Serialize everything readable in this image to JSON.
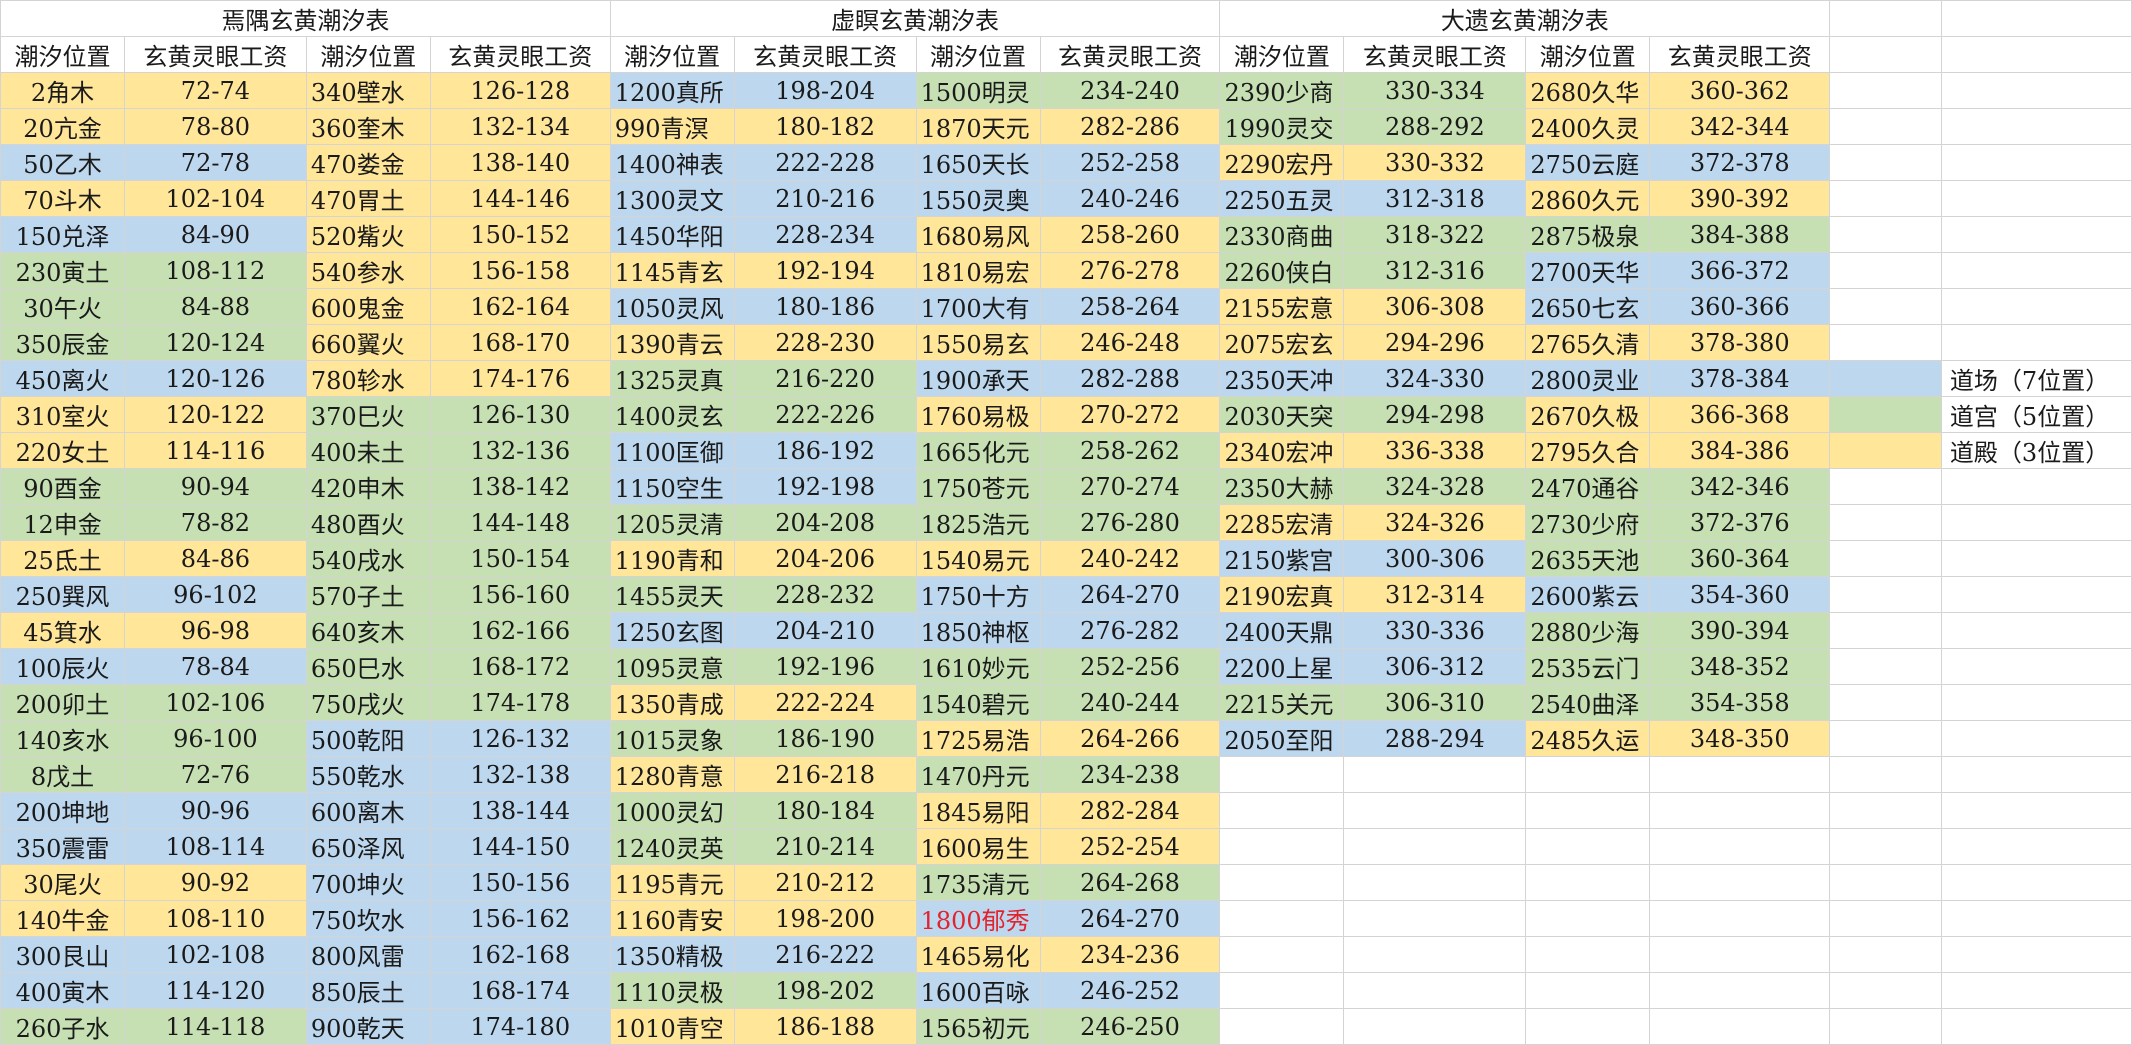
{
  "colors": {
    "Y": "#ffe699",
    "B": "#bdd7ee",
    "G": "#c6e0b4",
    "highlight_text": "#e0242f"
  },
  "titles": [
    "焉隅玄黄潮汐表",
    "虚瞑玄黄潮汐表",
    "大遗玄黄潮汐表"
  ],
  "header": [
    "潮汐位置",
    "玄黄灵眼工资"
  ],
  "legend": [
    {
      "label": "道场（7位置）",
      "color": "B"
    },
    {
      "label": "道宫（5位置）",
      "color": "G"
    },
    {
      "label": "道殿（3位置）",
      "color": "Y"
    }
  ],
  "tables": [
    {
      "left": [
        {
          "pos": "2角木",
          "val": "72-74",
          "c": "Y"
        },
        {
          "pos": "20亢金",
          "val": "78-80",
          "c": "Y"
        },
        {
          "pos": "50乙木",
          "val": "72-78",
          "c": "B"
        },
        {
          "pos": "70斗木",
          "val": "102-104",
          "c": "Y"
        },
        {
          "pos": "150兑泽",
          "val": "84-90",
          "c": "B"
        },
        {
          "pos": "230寅土",
          "val": "108-112",
          "c": "G"
        },
        {
          "pos": "30午火",
          "val": "84-88",
          "c": "G"
        },
        {
          "pos": "350辰金",
          "val": "120-124",
          "c": "G"
        },
        {
          "pos": "450离火",
          "val": "120-126",
          "c": "B"
        },
        {
          "pos": "310室火",
          "val": "120-122",
          "c": "Y"
        },
        {
          "pos": "220女土",
          "val": "114-116",
          "c": "Y"
        },
        {
          "pos": "90酉金",
          "val": "90-94",
          "c": "G"
        },
        {
          "pos": "12申金",
          "val": "78-82",
          "c": "G"
        },
        {
          "pos": "25氐土",
          "val": "84-86",
          "c": "Y"
        },
        {
          "pos": "250巽风",
          "val": "96-102",
          "c": "B"
        },
        {
          "pos": "45箕水",
          "val": "96-98",
          "c": "Y"
        },
        {
          "pos": "100辰火",
          "val": "78-84",
          "c": "B"
        },
        {
          "pos": "200卯土",
          "val": "102-106",
          "c": "G"
        },
        {
          "pos": "140亥水",
          "val": "96-100",
          "c": "G"
        },
        {
          "pos": "8戊土",
          "val": "72-76",
          "c": "G"
        },
        {
          "pos": "200坤地",
          "val": "90-96",
          "c": "B"
        },
        {
          "pos": "350震雷",
          "val": "108-114",
          "c": "B"
        },
        {
          "pos": "30尾火",
          "val": "90-92",
          "c": "Y"
        },
        {
          "pos": "140牛金",
          "val": "108-110",
          "c": "Y"
        },
        {
          "pos": "300艮山",
          "val": "102-108",
          "c": "B"
        },
        {
          "pos": "400寅木",
          "val": "114-120",
          "c": "B"
        },
        {
          "pos": "260子水",
          "val": "114-118",
          "c": "G"
        }
      ],
      "right": [
        {
          "pos": "340壁水",
          "val": "126-128",
          "c": "Y"
        },
        {
          "pos": "360奎木",
          "val": "132-134",
          "c": "Y"
        },
        {
          "pos": "470娄金",
          "val": "138-140",
          "c": "Y"
        },
        {
          "pos": "470胃土",
          "val": "144-146",
          "c": "Y"
        },
        {
          "pos": "520觜火",
          "val": "150-152",
          "c": "Y"
        },
        {
          "pos": "540参水",
          "val": "156-158",
          "c": "Y"
        },
        {
          "pos": "600鬼金",
          "val": "162-164",
          "c": "Y"
        },
        {
          "pos": "660翼火",
          "val": "168-170",
          "c": "Y"
        },
        {
          "pos": "780轸水",
          "val": "174-176",
          "c": "Y"
        },
        {
          "pos": "370巳火",
          "val": "126-130",
          "c": "G"
        },
        {
          "pos": "400未土",
          "val": "132-136",
          "c": "G"
        },
        {
          "pos": "420申木",
          "val": "138-142",
          "c": "G"
        },
        {
          "pos": "480酉火",
          "val": "144-148",
          "c": "G"
        },
        {
          "pos": "540戌水",
          "val": "150-154",
          "c": "G"
        },
        {
          "pos": "570子土",
          "val": "156-160",
          "c": "G"
        },
        {
          "pos": "640亥木",
          "val": "162-166",
          "c": "G"
        },
        {
          "pos": "650巳水",
          "val": "168-172",
          "c": "G"
        },
        {
          "pos": "750戌火",
          "val": "174-178",
          "c": "G"
        },
        {
          "pos": "500乾阳",
          "val": "126-132",
          "c": "B"
        },
        {
          "pos": "550乾水",
          "val": "132-138",
          "c": "B"
        },
        {
          "pos": "600离木",
          "val": "138-144",
          "c": "B"
        },
        {
          "pos": "650泽风",
          "val": "144-150",
          "c": "B"
        },
        {
          "pos": "700坤火",
          "val": "150-156",
          "c": "B"
        },
        {
          "pos": "750坎水",
          "val": "156-162",
          "c": "B"
        },
        {
          "pos": "800风雷",
          "val": "162-168",
          "c": "B"
        },
        {
          "pos": "850辰土",
          "val": "168-174",
          "c": "B"
        },
        {
          "pos": "900乾天",
          "val": "174-180",
          "c": "B"
        }
      ]
    },
    {
      "left": [
        {
          "pos": "1200真所",
          "val": "198-204",
          "c": "B"
        },
        {
          "pos": "990青溟",
          "val": "180-182",
          "c": "Y"
        },
        {
          "pos": "1400神表",
          "val": "222-228",
          "c": "B"
        },
        {
          "pos": "1300灵文",
          "val": "210-216",
          "c": "B"
        },
        {
          "pos": "1450华阳",
          "val": "228-234",
          "c": "B"
        },
        {
          "pos": "1145青玄",
          "val": "192-194",
          "c": "Y"
        },
        {
          "pos": "1050灵风",
          "val": "180-186",
          "c": "B"
        },
        {
          "pos": "1390青云",
          "val": "228-230",
          "c": "Y"
        },
        {
          "pos": "1325灵真",
          "val": "216-220",
          "c": "G"
        },
        {
          "pos": "1400灵玄",
          "val": "222-226",
          "c": "G"
        },
        {
          "pos": "1100匡御",
          "val": "186-192",
          "c": "B"
        },
        {
          "pos": "1150空生",
          "val": "192-198",
          "c": "B"
        },
        {
          "pos": "1205灵清",
          "val": "204-208",
          "c": "G"
        },
        {
          "pos": "1190青和",
          "val": "204-206",
          "c": "Y"
        },
        {
          "pos": "1455灵天",
          "val": "228-232",
          "c": "G"
        },
        {
          "pos": "1250玄图",
          "val": "204-210",
          "c": "B"
        },
        {
          "pos": "1095灵意",
          "val": "192-196",
          "c": "G"
        },
        {
          "pos": "1350青成",
          "val": "222-224",
          "c": "Y"
        },
        {
          "pos": "1015灵象",
          "val": "186-190",
          "c": "G"
        },
        {
          "pos": "1280青意",
          "val": "216-218",
          "c": "Y"
        },
        {
          "pos": "1000灵幻",
          "val": "180-184",
          "c": "G"
        },
        {
          "pos": "1240灵英",
          "val": "210-214",
          "c": "G"
        },
        {
          "pos": "1195青元",
          "val": "210-212",
          "c": "Y"
        },
        {
          "pos": "1160青安",
          "val": "198-200",
          "c": "Y"
        },
        {
          "pos": "1350精极",
          "val": "216-222",
          "c": "B"
        },
        {
          "pos": "1110灵极",
          "val": "198-202",
          "c": "G"
        },
        {
          "pos": "1010青空",
          "val": "186-188",
          "c": "Y"
        }
      ],
      "right": [
        {
          "pos": "1500明灵",
          "val": "234-240",
          "c": "G"
        },
        {
          "pos": "1870天元",
          "val": "282-286",
          "c": "Y"
        },
        {
          "pos": "1650天长",
          "val": "252-258",
          "c": "B"
        },
        {
          "pos": "1550灵奥",
          "val": "240-246",
          "c": "B"
        },
        {
          "pos": "1680易风",
          "val": "258-260",
          "c": "Y"
        },
        {
          "pos": "1810易宏",
          "val": "276-278",
          "c": "Y"
        },
        {
          "pos": "1700大有",
          "val": "258-264",
          "c": "B"
        },
        {
          "pos": "1550易玄",
          "val": "246-248",
          "c": "Y"
        },
        {
          "pos": "1900承天",
          "val": "282-288",
          "c": "B"
        },
        {
          "pos": "1760易极",
          "val": "270-272",
          "c": "Y"
        },
        {
          "pos": "1665化元",
          "val": "258-262",
          "c": "G"
        },
        {
          "pos": "1750苍元",
          "val": "270-274",
          "c": "G"
        },
        {
          "pos": "1825浩元",
          "val": "276-280",
          "c": "G"
        },
        {
          "pos": "1540易元",
          "val": "240-242",
          "c": "Y"
        },
        {
          "pos": "1750十方",
          "val": "264-270",
          "c": "B"
        },
        {
          "pos": "1850神枢",
          "val": "276-282",
          "c": "B"
        },
        {
          "pos": "1610妙元",
          "val": "252-256",
          "c": "G"
        },
        {
          "pos": "1540碧元",
          "val": "240-244",
          "c": "G"
        },
        {
          "pos": "1725易浩",
          "val": "264-266",
          "c": "Y"
        },
        {
          "pos": "1470丹元",
          "val": "234-238",
          "c": "G"
        },
        {
          "pos": "1845易阳",
          "val": "282-284",
          "c": "Y"
        },
        {
          "pos": "1600易生",
          "val": "252-254",
          "c": "Y"
        },
        {
          "pos": "1735清元",
          "val": "264-268",
          "c": "G"
        },
        {
          "pos": "1800郁秀",
          "val": "264-270",
          "c": "B",
          "red": true
        },
        {
          "pos": "1465易化",
          "val": "234-236",
          "c": "Y"
        },
        {
          "pos": "1600百咏",
          "val": "246-252",
          "c": "B"
        },
        {
          "pos": "1565初元",
          "val": "246-250",
          "c": "G"
        }
      ]
    },
    {
      "left": [
        {
          "pos": "2390少商",
          "val": "330-334",
          "c": "G"
        },
        {
          "pos": "1990灵交",
          "val": "288-292",
          "c": "G"
        },
        {
          "pos": "2290宏丹",
          "val": "330-332",
          "c": "Y"
        },
        {
          "pos": "2250五灵",
          "val": "312-318",
          "c": "B"
        },
        {
          "pos": "2330商曲",
          "val": "318-322",
          "c": "G"
        },
        {
          "pos": "2260侠白",
          "val": "312-316",
          "c": "G"
        },
        {
          "pos": "2155宏意",
          "val": "306-308",
          "c": "Y"
        },
        {
          "pos": "2075宏玄",
          "val": "294-296",
          "c": "Y"
        },
        {
          "pos": "2350天冲",
          "val": "324-330",
          "c": "B"
        },
        {
          "pos": "2030天突",
          "val": "294-298",
          "c": "G"
        },
        {
          "pos": "2340宏冲",
          "val": "336-338",
          "c": "Y"
        },
        {
          "pos": "2350大赫",
          "val": "324-328",
          "c": "G"
        },
        {
          "pos": "2285宏清",
          "val": "324-326",
          "c": "Y"
        },
        {
          "pos": "2150紫宫",
          "val": "300-306",
          "c": "B"
        },
        {
          "pos": "2190宏真",
          "val": "312-314",
          "c": "Y"
        },
        {
          "pos": "2400天鼎",
          "val": "330-336",
          "c": "B"
        },
        {
          "pos": "2200上星",
          "val": "306-312",
          "c": "B"
        },
        {
          "pos": "2215关元",
          "val": "306-310",
          "c": "G"
        },
        {
          "pos": "2050至阳",
          "val": "288-294",
          "c": "B"
        }
      ],
      "right": [
        {
          "pos": "2680久华",
          "val": "360-362",
          "c": "Y"
        },
        {
          "pos": "2400久灵",
          "val": "342-344",
          "c": "Y"
        },
        {
          "pos": "2750云庭",
          "val": "372-378",
          "c": "B"
        },
        {
          "pos": "2860久元",
          "val": "390-392",
          "c": "Y"
        },
        {
          "pos": "2875极泉",
          "val": "384-388",
          "c": "G"
        },
        {
          "pos": "2700天华",
          "val": "366-372",
          "c": "B"
        },
        {
          "pos": "2650七玄",
          "val": "360-366",
          "c": "B"
        },
        {
          "pos": "2765久清",
          "val": "378-380",
          "c": "Y"
        },
        {
          "pos": "2800灵业",
          "val": "378-384",
          "c": "B"
        },
        {
          "pos": "2670久极",
          "val": "366-368",
          "c": "Y"
        },
        {
          "pos": "2795久合",
          "val": "384-386",
          "c": "Y"
        },
        {
          "pos": "2470通谷",
          "val": "342-346",
          "c": "G"
        },
        {
          "pos": "2730少府",
          "val": "372-376",
          "c": "G"
        },
        {
          "pos": "2635天池",
          "val": "360-364",
          "c": "G"
        },
        {
          "pos": "2600紫云",
          "val": "354-360",
          "c": "B"
        },
        {
          "pos": "2880少海",
          "val": "390-394",
          "c": "G"
        },
        {
          "pos": "2535云门",
          "val": "348-352",
          "c": "G"
        },
        {
          "pos": "2540曲泽",
          "val": "354-358",
          "c": "G"
        },
        {
          "pos": "2485久运",
          "val": "348-350",
          "c": "Y"
        }
      ]
    }
  ]
}
